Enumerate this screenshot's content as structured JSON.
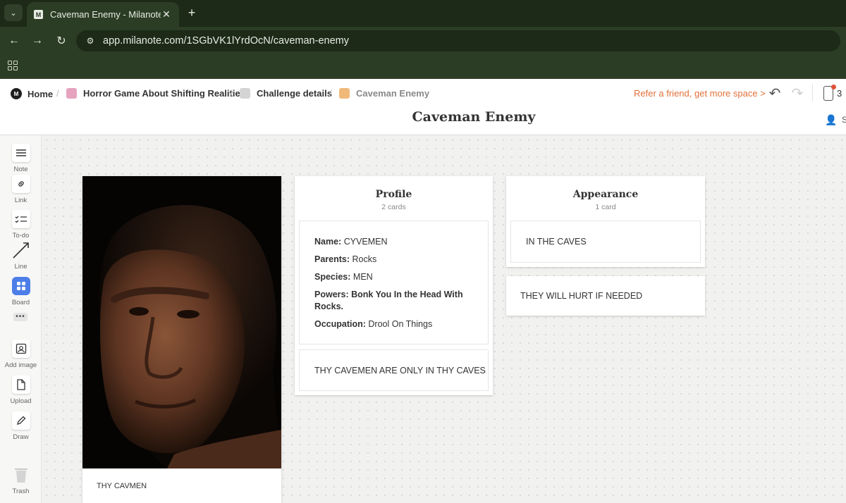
{
  "browser": {
    "tab": {
      "title": "Caveman Enemy - Milanote",
      "favicon": "M"
    },
    "url": "app.milanote.com/1SGbVK1lYrdOcN/caveman-enemy"
  },
  "header": {
    "breadcrumbs": [
      {
        "label": "Home"
      },
      {
        "label": "Horror Game About Shifting Realities",
        "color": "#e6a3be"
      },
      {
        "label": "Challenge details",
        "color": "#d4d4d4"
      },
      {
        "label": "Caveman Enemy",
        "color": "#f0b97a"
      }
    ],
    "refer": "Refer a friend, get more space >",
    "device_count": "3",
    "board_title": "Caveman Enemy",
    "share_partial": "S"
  },
  "toolbar": {
    "note": "Note",
    "link": "Link",
    "todo": "To-do",
    "line": "Line",
    "board": "Board",
    "more": "•••",
    "add_image": "Add image",
    "upload": "Upload",
    "draw": "Draw",
    "trash": "Trash"
  },
  "image_card": {
    "caption": "THY CAVMEN"
  },
  "profile": {
    "title": "Profile",
    "count": "2 cards",
    "fields": [
      {
        "label": "Name:",
        "value": "CYVEMEN"
      },
      {
        "label": "Parents:",
        "value": "Rocks"
      },
      {
        "label": "Species:",
        "value": "MEN"
      },
      {
        "label": "Powers:",
        "value": "Bonk You In the Head With Rocks."
      },
      {
        "label": "Occupation:",
        "value": "Drool On Things"
      }
    ],
    "note2": "THY CAVEMEN ARE ONLY IN THY CAVES"
  },
  "appearance": {
    "title": "Appearance",
    "count": "1 card",
    "note": "IN THE CAVES"
  },
  "free_note": "THEY WILL HURT IF NEEDED",
  "colors": {
    "accent": "#e0703a",
    "board_tool": "#4d7ee8",
    "chrome": "#2b3d24"
  }
}
